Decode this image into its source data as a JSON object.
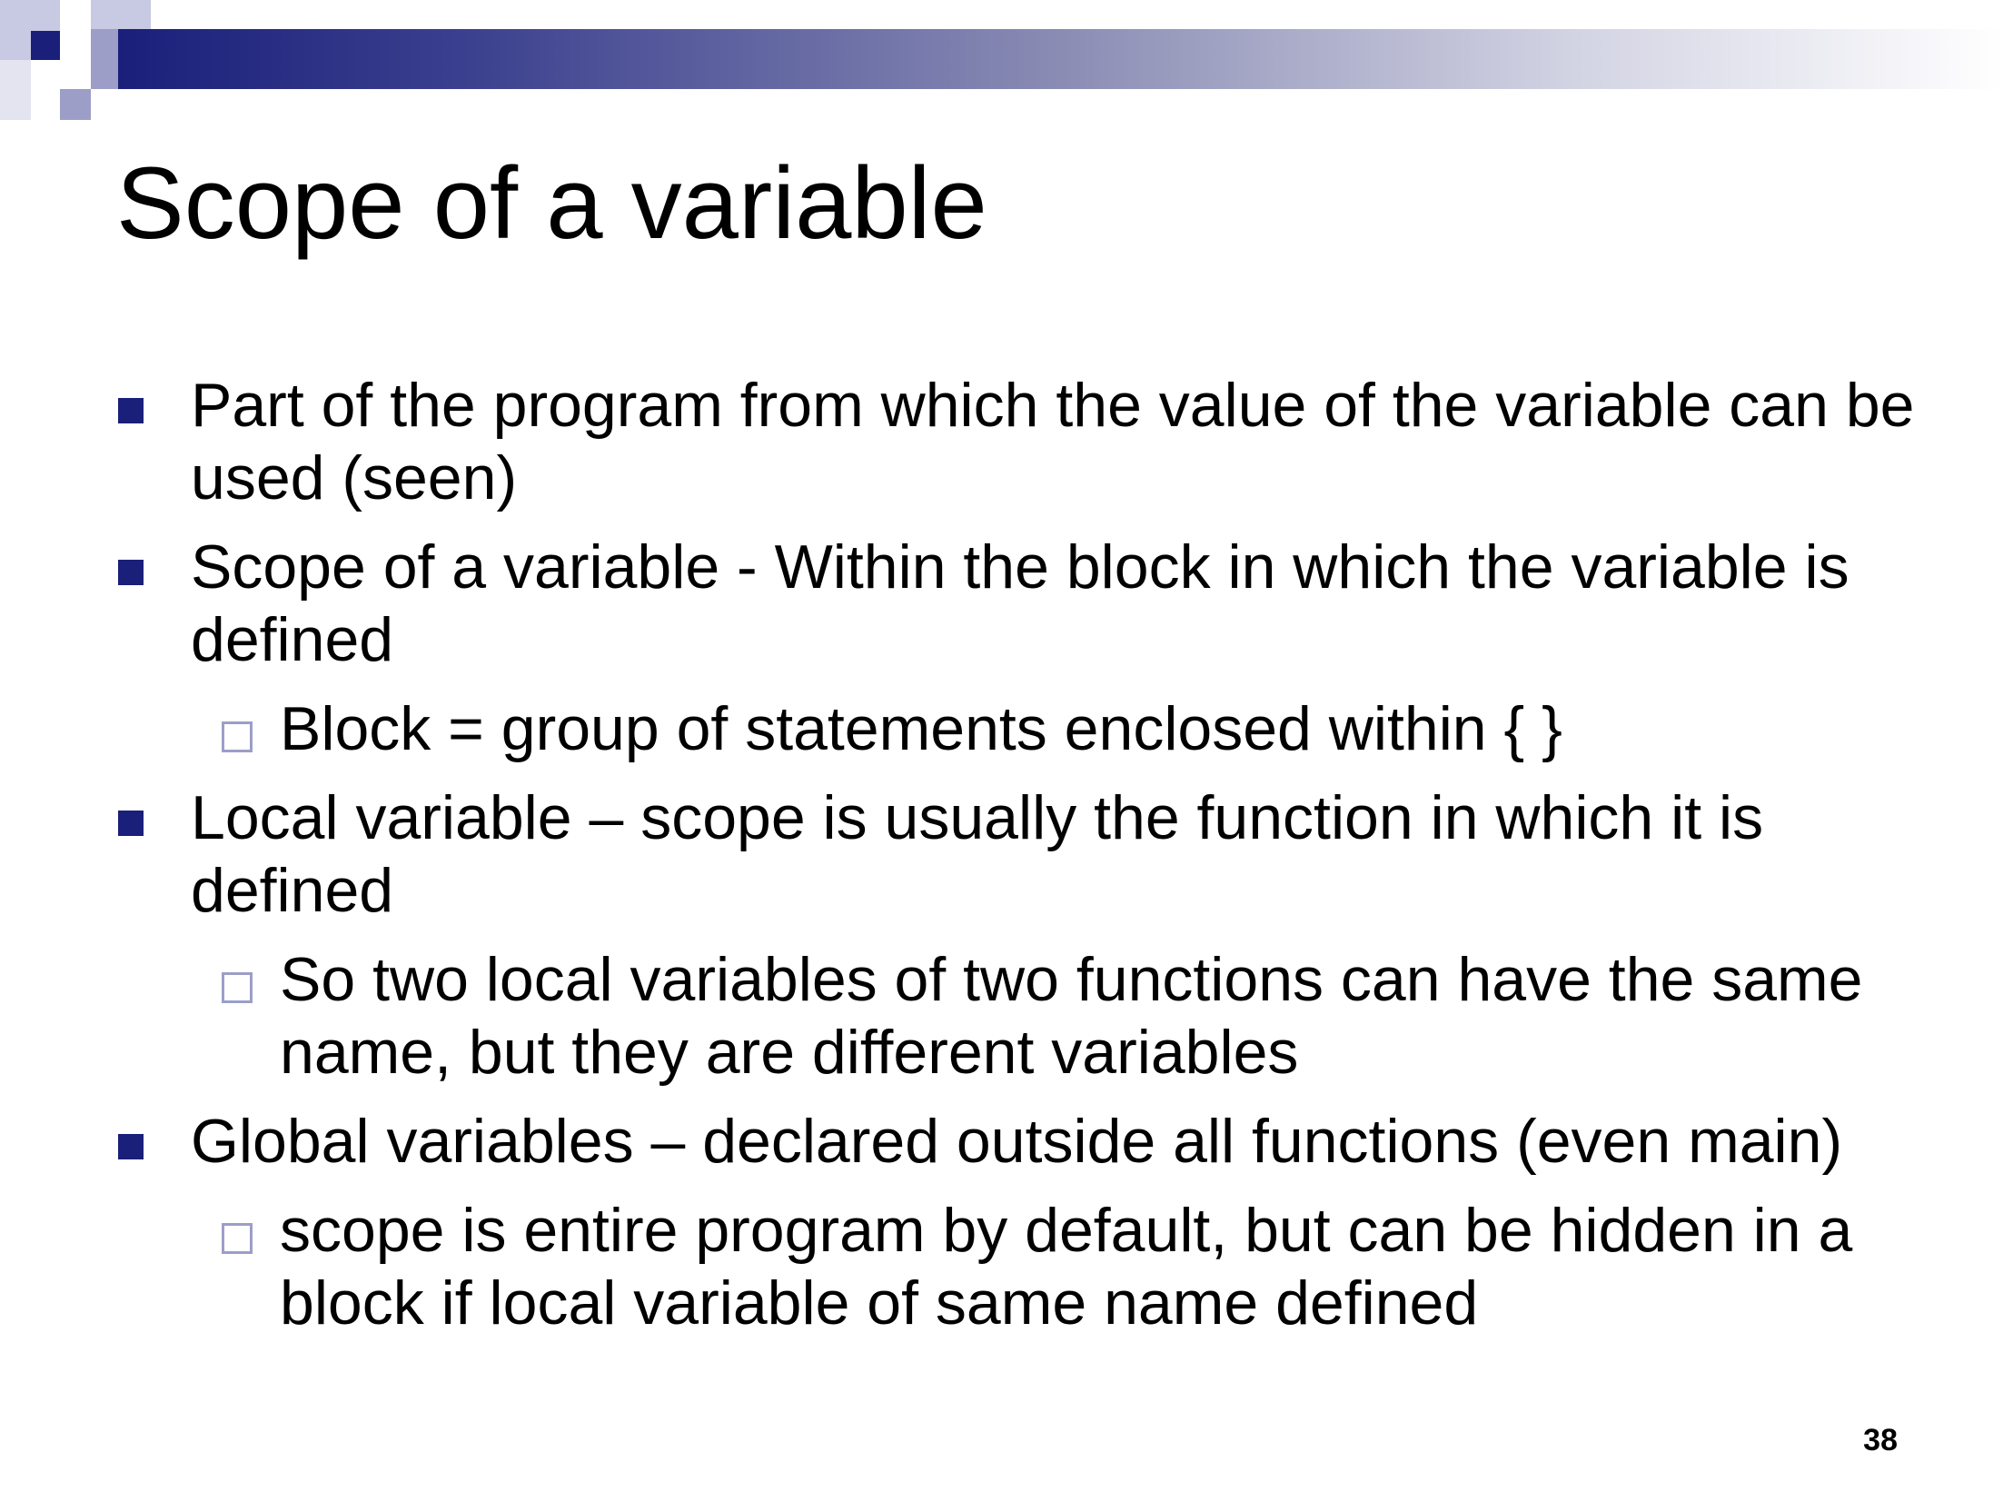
{
  "slide": {
    "title": "Scope of a variable",
    "page_number": "38",
    "colors": {
      "accent_dark": "#1a1f7a",
      "accent_light": "#9c9ec8"
    },
    "bullets": [
      {
        "level": 1,
        "text": "Part of the program from which the value of the variable can be used (seen)"
      },
      {
        "level": 1,
        "text": "Scope of a variable - Within the block in which the variable is defined"
      },
      {
        "level": 2,
        "text": "Block = group of statements enclosed within { }"
      },
      {
        "level": 1,
        "text": "Local variable – scope is usually the function in which it is defined"
      },
      {
        "level": 2,
        "text": "So two local variables of two functions can have the same name, but they are different variables"
      },
      {
        "level": 1,
        "text": "Global variables – declared outside all functions (even main)"
      },
      {
        "level": 2,
        "text": "scope is entire program by default, but can be hidden in a block if local variable of same name defined"
      }
    ]
  }
}
